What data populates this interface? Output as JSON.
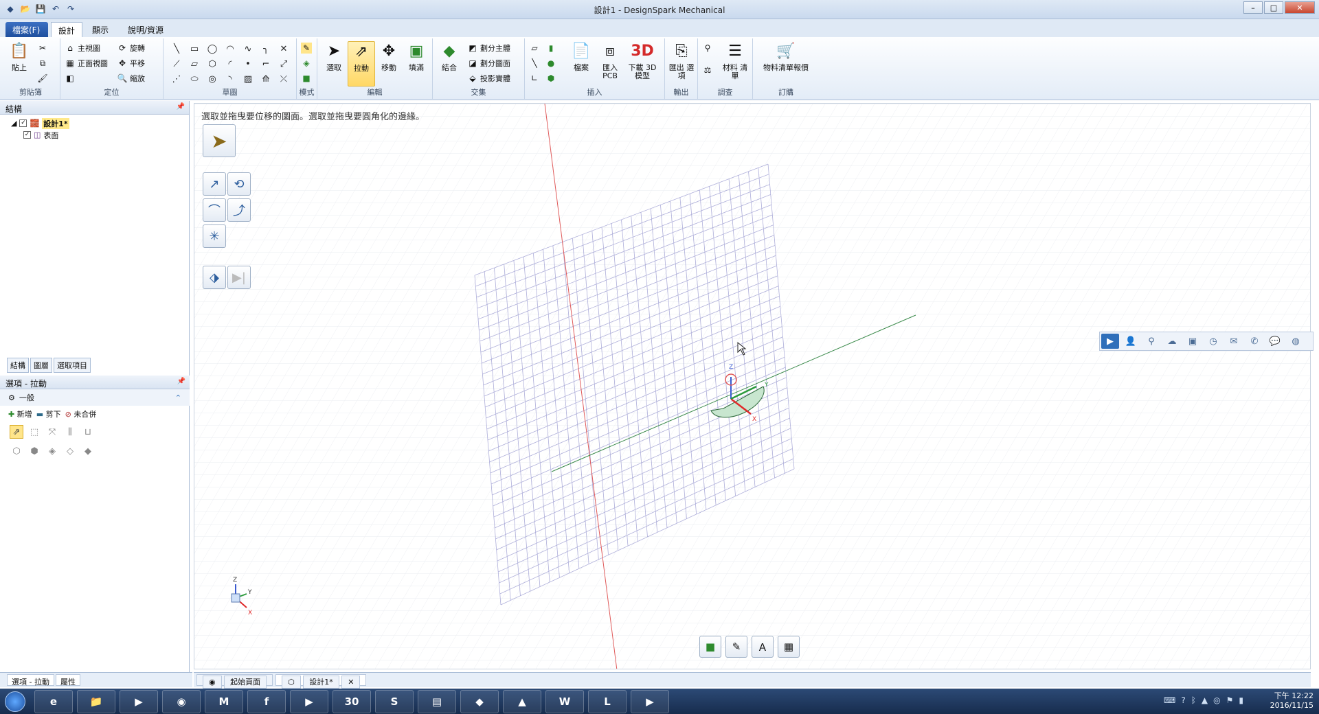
{
  "window": {
    "title": "設計1 - DesignSpark Mechanical"
  },
  "tabs": [
    {
      "label": "檔案(F)"
    },
    {
      "label": "設計"
    },
    {
      "label": "顯示"
    },
    {
      "label": "說明/資源"
    }
  ],
  "ribbon": {
    "clipboard": {
      "paste": "貼上",
      "label": "剪貼簿"
    },
    "orient": {
      "home": "主視圖",
      "front": "正面視圖",
      "rotate": "旋轉",
      "pan": "平移",
      "zoom": "縮放",
      "label": "定位"
    },
    "sketch": {
      "label": "草圖"
    },
    "mode": {
      "label": "模式"
    },
    "edit": {
      "select": "選取",
      "pull": "拉動",
      "move": "移動",
      "fill": "填滿",
      "label": "編輯"
    },
    "intersect": {
      "combine": "結合",
      "split_body": "劃分主體",
      "split_face": "劃分圖面",
      "project": "投影實體",
      "label": "交集"
    },
    "insert": {
      "file": "檔案",
      "import_pcb": "匯入 PCB",
      "download_3d": "下載 3D 模型",
      "label": "插入"
    },
    "output": {
      "export": "匯出 選項",
      "label": "輸出"
    },
    "investigate": {
      "bom": "材料 清單",
      "label": "調查"
    },
    "order": {
      "quote": "物料清單報價",
      "label": "訂購"
    }
  },
  "structure_panel": {
    "title": "結構",
    "items": [
      {
        "label": "設計1*"
      },
      {
        "label": "表面"
      }
    ],
    "tabs": [
      "結構",
      "圖層",
      "選取項目"
    ]
  },
  "options_panel": {
    "title": "選項 - 拉動",
    "section": "一般",
    "add": "新增",
    "cut": "剪下",
    "no_merge": "未合併"
  },
  "canvas": {
    "hint": "選取並拖曳要位移的圖面。選取並拖曳要圓角化的邊緣。",
    "axis_x": "X",
    "axis_y": "Y",
    "axis_z": "Z"
  },
  "bottom_left_tabs": [
    "選項 - 拉動",
    "屬性"
  ],
  "doc_tabs": [
    {
      "label": "起始頁面"
    },
    {
      "label": "設計1*"
    }
  ],
  "taskbar": {
    "calendar_day": "30",
    "time": "下午 12:22",
    "date": "2016/11/15"
  }
}
